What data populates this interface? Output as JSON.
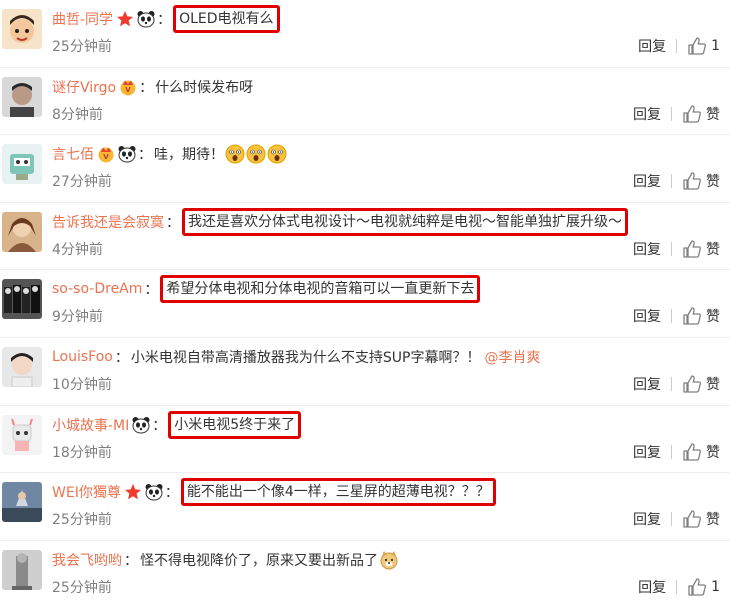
{
  "comments": [
    {
      "user": "曲哲-同学",
      "badges": [
        "star-icon",
        "panda-icon"
      ],
      "text": "OLED电视有么",
      "boxed": true,
      "time": "25分钟前",
      "reply": "回复",
      "like": "1"
    },
    {
      "user": "谜仔Virgo",
      "badges": [
        "vip-crown-icon"
      ],
      "text": "什么时候发布呀",
      "boxed": false,
      "time": "8分钟前",
      "reply": "回复",
      "like": "赞"
    },
    {
      "user": "言七佰",
      "badges": [
        "vip-crown-icon",
        "panda-icon"
      ],
      "text": "哇，期待！",
      "boxed": false,
      "emojis": [
        "shocked-face-icon",
        "shocked-face-icon",
        "shocked-face-icon"
      ],
      "time": "27分钟前",
      "reply": "回复",
      "like": "赞"
    },
    {
      "user": "告诉我还是会寂寞",
      "badges": [],
      "text": "我还是喜欢分体式电视设计～电视就纯粹是电视～智能单独扩展升级～",
      "boxed": true,
      "time": "4分钟前",
      "reply": "回复",
      "like": "赞"
    },
    {
      "user": "so-so-DreAm",
      "badges": [],
      "text": "希望分体电视和分体电视的音箱可以一直更新下去",
      "boxed": true,
      "time": "9分钟前",
      "reply": "回复",
      "like": "赞"
    },
    {
      "user": "LouisFoo",
      "badges": [],
      "text": "小米电视自带高清播放器我为什么不支持SUP字幕啊？！",
      "boxed": false,
      "mention": "@李肖爽",
      "time": "10分钟前",
      "reply": "回复",
      "like": "赞"
    },
    {
      "user": "小城故事-MI",
      "badges": [
        "panda-icon"
      ],
      "text": "小米电视5终于来了",
      "boxed": true,
      "time": "18分钟前",
      "reply": "回复",
      "like": "赞"
    },
    {
      "user": "WEI你獨尊",
      "badges": [
        "star-icon",
        "panda-icon"
      ],
      "text": "能不能出一个像4一样，三星屏的超薄电视？？？",
      "boxed": true,
      "time": "25分钟前",
      "reply": "回复",
      "like": "赞"
    },
    {
      "user": "我会飞哟哟",
      "badges": [],
      "text": "怪不得电视降价了，原来又要出新品了",
      "boxed": false,
      "emojis": [
        "doge-icon"
      ],
      "time": "25分钟前",
      "reply": "回复",
      "like": "1"
    }
  ],
  "colors": {
    "username": "#eb7350",
    "highlight_box": "#e00000",
    "timestamp": "#808080"
  }
}
